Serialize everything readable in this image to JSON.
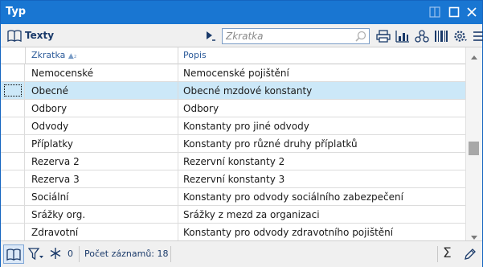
{
  "window": {
    "title": "Typ"
  },
  "toolbar": {
    "label": "Texty",
    "search_placeholder": "Zkratka"
  },
  "grid": {
    "columns": [
      {
        "label": "Zkratka",
        "sort": "▲₂"
      },
      {
        "label": "Popis"
      }
    ],
    "rows": [
      {
        "code": "Nemocenské",
        "desc": "Nemocenské pojištění",
        "selected": false
      },
      {
        "code": "Obecné",
        "desc": "Obecné mzdové konstanty",
        "selected": true
      },
      {
        "code": "Odbory",
        "desc": "Odbory",
        "selected": false
      },
      {
        "code": "Odvody",
        "desc": "Konstanty pro jiné odvody",
        "selected": false
      },
      {
        "code": "Příplatky",
        "desc": "Konstanty pro různé druhy příplatků",
        "selected": false
      },
      {
        "code": "Rezerva 2",
        "desc": "Rezervní konstanty 2",
        "selected": false
      },
      {
        "code": "Rezerva 3",
        "desc": "Rezervní konstanty 3",
        "selected": false
      },
      {
        "code": "Sociální",
        "desc": "Konstanty pro odvody sociálního zabezpečení",
        "selected": false
      },
      {
        "code": "Srážky org.",
        "desc": "Srážky z mezd za organizaci",
        "selected": false
      },
      {
        "code": "Zdravotní",
        "desc": "Konstanty pro odvody zdravotního pojištění",
        "selected": false
      }
    ]
  },
  "status": {
    "filter_count": "0",
    "records_label": "Počet záznamů: 18"
  },
  "colors": {
    "titlebar": "#1976d2",
    "selection": "#cce8f8",
    "header_text": "#2b5a99"
  },
  "icons": [
    "restore-icon",
    "maximize-icon",
    "close-icon",
    "book-icon",
    "run-arrow-icon",
    "search-icon",
    "print-icon",
    "chart-icon",
    "tree-icon",
    "barcode-icon",
    "settings-icon",
    "menu-icon",
    "filter-icon",
    "snowflake-icon",
    "sigma-icon",
    "edit-icon"
  ]
}
